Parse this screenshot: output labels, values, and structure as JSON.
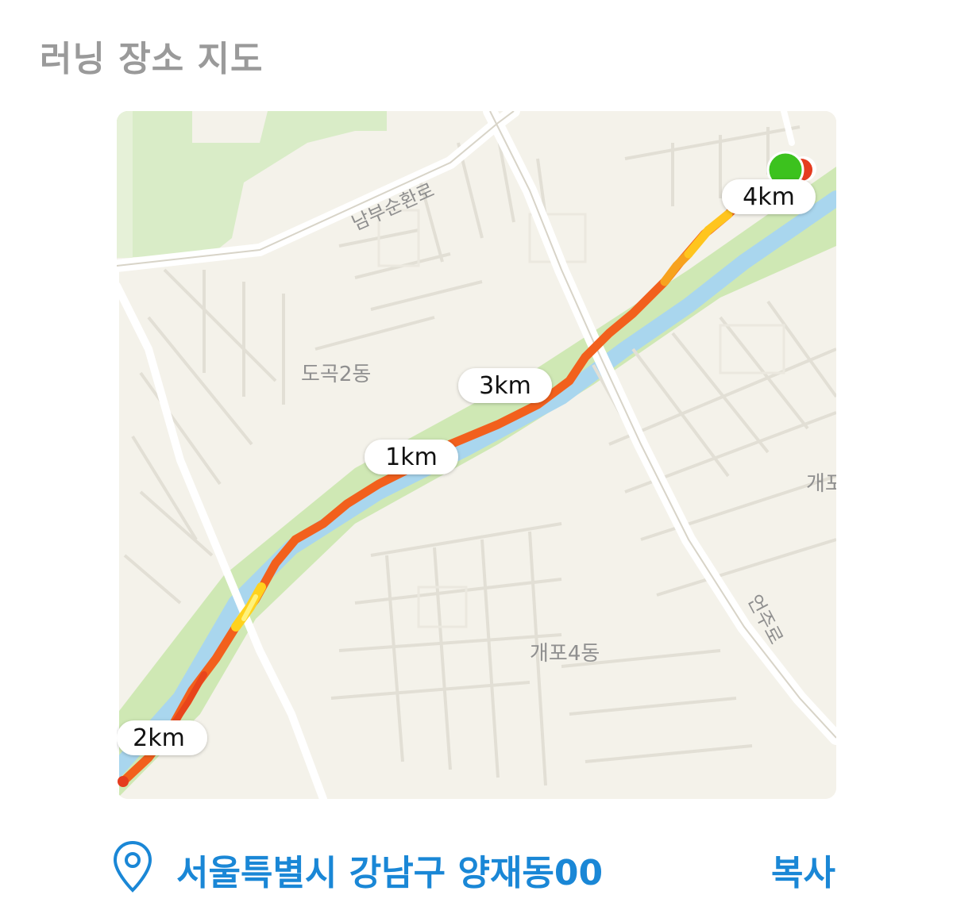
{
  "header": {
    "title": "러닝 장소 지도"
  },
  "map": {
    "road_labels": {
      "nambu": "남부순환로",
      "eonju": "언주로"
    },
    "area_labels": {
      "dogok": "도곡2동",
      "gaepo4": "개포4동",
      "gaepo_edge": "개포"
    },
    "distance_markers": {
      "km1": "1km",
      "km2": "2km",
      "km3": "3km",
      "km4": "4km"
    },
    "colors": {
      "land": "#f4f2ea",
      "park": "#cfe8b4",
      "water": "#a9d6ee",
      "road": "#ffffff",
      "route_main": "#f2601d",
      "route_fast": "#ffd21e",
      "start_marker": "#3cc21e",
      "end_marker": "#e53c1f"
    }
  },
  "footer": {
    "location_icon": "map-pin-icon",
    "address": "서울특별시 강남구 양재동00",
    "copy_label": "복사"
  }
}
